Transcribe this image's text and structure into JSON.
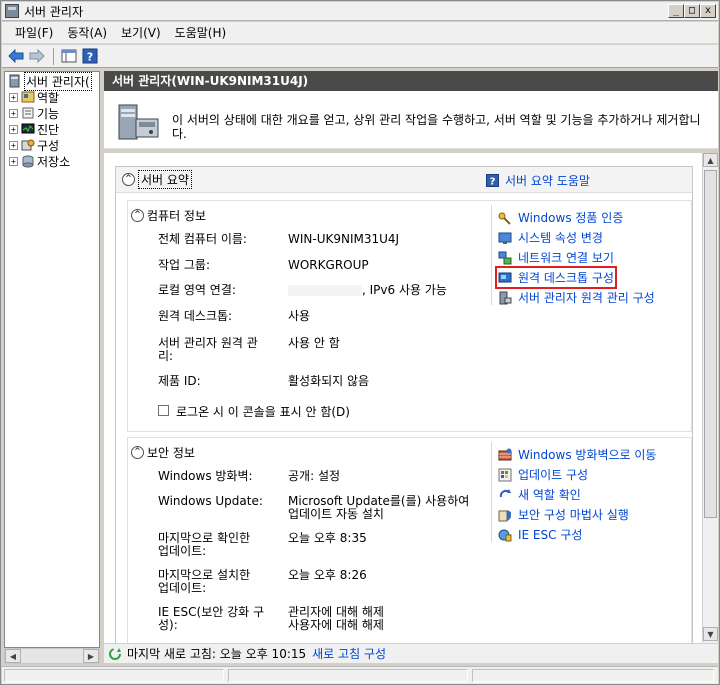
{
  "window": {
    "title": "서버 관리자",
    "min_label": "_",
    "max_label": "□",
    "close_label": "x"
  },
  "menu": [
    "파일(F)",
    "동작(A)",
    "보기(V)",
    "도움말(H)"
  ],
  "tree": {
    "root": "서버 관리자(",
    "items": [
      "역할",
      "기능",
      "진단",
      "구성",
      "저장소"
    ],
    "expander": "+"
  },
  "main": {
    "header": "서버 관리자(WIN-UK9NIM31U4J)",
    "intro": "이 서버의 상태에 대한 개요를 얻고, 상위 관리 작업을 수행하고, 서버 역할 및 기능을 추가하거나 제거합니다."
  },
  "summary": {
    "title": "서버 요약",
    "help_link": "서버 요약 도움말",
    "computer_info": {
      "title": "컴퓨터 정보",
      "props": [
        {
          "label": "전체 컴퓨터 이름:",
          "value": "WIN-UK9NIM31U4J"
        },
        {
          "label": "작업 그룹:",
          "value": "WORKGROUP"
        },
        {
          "label": "로컬 영역 연결:",
          "value": ", IPv6 사용 가능"
        },
        {
          "label": "원격 데스크톱:",
          "value": "사용"
        },
        {
          "label": "서버 관리자 원격 관리:",
          "value": "사용 안 함"
        },
        {
          "label": "제품 ID:",
          "value": "활성화되지 않음"
        }
      ],
      "checkbox_label": "로그온 시 이 콘솔을 표시 안 함(D)",
      "tasks": [
        "Windows 정품 인증",
        "시스템 속성 변경",
        "네트워크 연결 보기",
        "원격 데스크톱 구성",
        "서버 관리자 원격 관리 구성"
      ]
    },
    "security_info": {
      "title": "보안 정보",
      "props": [
        {
          "label": "Windows 방화벽:",
          "value": "공개: 설정"
        },
        {
          "label": "Windows Update:",
          "value": "Microsoft Update를(를) 사용하여 업데이트 자동 설치"
        },
        {
          "label": "마지막으로 확인한 업데이트:",
          "value": "오늘 오후 8:35"
        },
        {
          "label": "마지막으로 설치한 업데이트:",
          "value": "오늘 오후 8:26"
        },
        {
          "label": "IE ESC(보안 강화 구성):",
          "value": "관리자에 대해 해제\n사용자에 대해 해제"
        }
      ],
      "tasks": [
        "Windows 방화벽으로 이동",
        "업데이트 구성",
        "새 역할 확인",
        "보안 구성 마법사 실행",
        "IE ESC 구성"
      ]
    }
  },
  "status": {
    "text": "마지막 새로 고침: 오늘 오후 10:15",
    "link": "새로 고침 구성"
  },
  "colors": {
    "link": "#0046d5",
    "header_bg": "#4a4a4a",
    "highlight": "#e02020"
  }
}
